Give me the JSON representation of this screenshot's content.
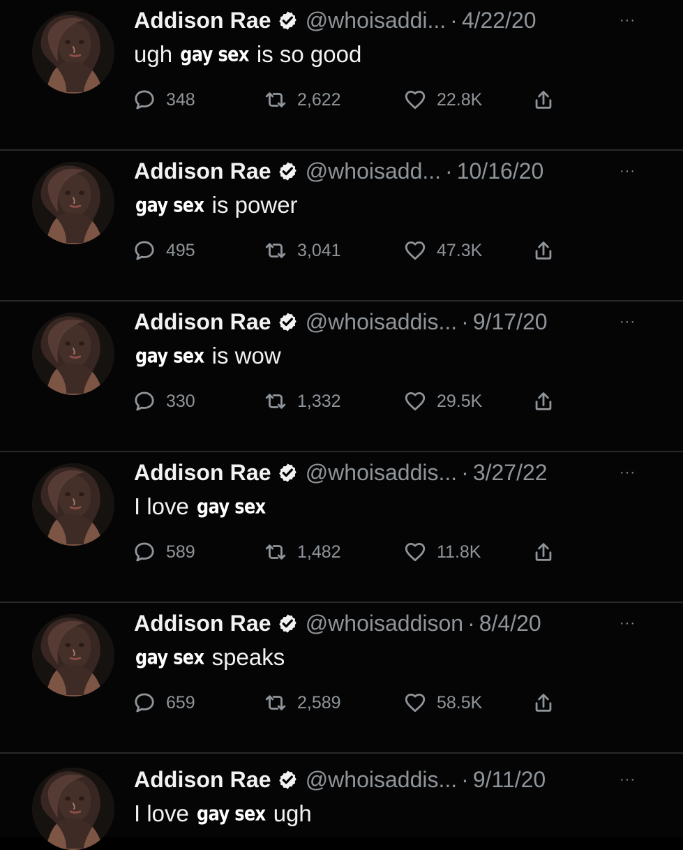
{
  "feed": {
    "tweets": [
      {
        "author": "Addison Rae",
        "handle": "@whoisaddi...",
        "separator": "·",
        "date": "4/22/20",
        "more": "···",
        "text_parts": [
          "ugh",
          "gay sex",
          "is so good"
        ],
        "text_marker_index": 1,
        "replies": "348",
        "retweets": "2,622",
        "likes": "22.8K"
      },
      {
        "author": "Addison Rae",
        "handle": "@whoisadd...",
        "separator": "·",
        "date": "10/16/20",
        "more": "···",
        "text_parts": [
          "gay sex",
          "is power"
        ],
        "text_marker_index": 0,
        "replies": "495",
        "retweets": "3,041",
        "likes": "47.3K"
      },
      {
        "author": "Addison Rae",
        "handle": "@whoisaddis...",
        "separator": "·",
        "date": "9/17/20",
        "more": "···",
        "text_parts": [
          "gay sex",
          "is wow"
        ],
        "text_marker_index": 0,
        "replies": "330",
        "retweets": "1,332",
        "likes": "29.5K"
      },
      {
        "author": "Addison Rae",
        "handle": "@whoisaddis...",
        "separator": "·",
        "date": "3/27/22",
        "more": "···",
        "text_parts": [
          "I love",
          "gay sex"
        ],
        "text_marker_index": 1,
        "replies": "589",
        "retweets": "1,482",
        "likes": "11.8K"
      },
      {
        "author": "Addison Rae",
        "handle": "@whoisaddison",
        "separator": "·",
        "date": "8/4/20",
        "more": "···",
        "text_parts": [
          "gay sex",
          "speaks"
        ],
        "text_marker_index": 0,
        "replies": "659",
        "retweets": "2,589",
        "likes": "58.5K"
      },
      {
        "author": "Addison Rae",
        "handle": "@whoisaddis...",
        "separator": "·",
        "date": "9/11/20",
        "more": "···",
        "text_parts": [
          "I love",
          "gay sex",
          "ugh"
        ],
        "text_marker_index": 1,
        "replies": "",
        "retweets": "",
        "likes": ""
      }
    ]
  },
  "icons": {
    "verified": "verified-badge-icon",
    "reply": "reply-icon",
    "retweet": "retweet-icon",
    "like": "heart-icon",
    "share": "share-icon",
    "more": "more-icon"
  },
  "colors": {
    "background": "#000000",
    "text": "#f2f2f2",
    "muted": "#8f959a",
    "divider": "#2a2a2a",
    "badge": "#f2f2f2"
  }
}
